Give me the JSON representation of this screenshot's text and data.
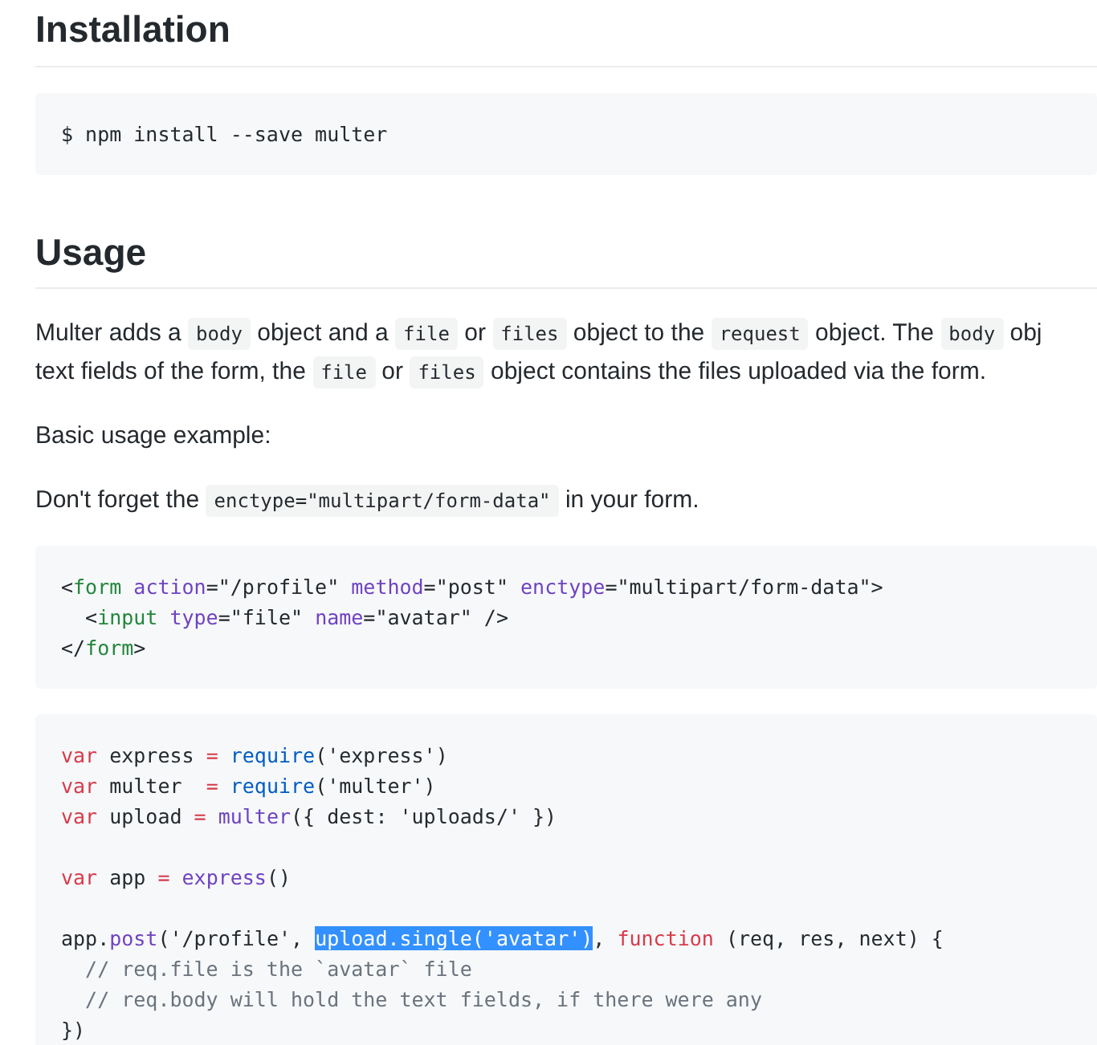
{
  "sections": [
    {
      "heading": "Installation",
      "blocks": [
        {
          "kind": "code",
          "groups": [
            [
              [
                {
                  "kind": "plain",
                  "t": "$ npm install --save multer"
                }
              ]
            ]
          ]
        }
      ]
    },
    {
      "heading": "Usage",
      "blocks": [
        {
          "kind": "paragraph",
          "lines": [
            [
              {
                "kind": "text",
                "t": "Multer adds a "
              },
              {
                "kind": "code",
                "t": "body"
              },
              {
                "kind": "text",
                "t": " object and a "
              },
              {
                "kind": "code",
                "t": "file"
              },
              {
                "kind": "text",
                "t": " or "
              },
              {
                "kind": "code",
                "t": "files"
              },
              {
                "kind": "text",
                "t": " object to the "
              },
              {
                "kind": "code",
                "t": "request"
              },
              {
                "kind": "text",
                "t": " object. The "
              },
              {
                "kind": "code",
                "t": "body"
              },
              {
                "kind": "text",
                "t": " obj"
              }
            ],
            [
              {
                "kind": "text",
                "t": "text fields of the form, the "
              },
              {
                "kind": "code",
                "t": "file"
              },
              {
                "kind": "text",
                "t": " or "
              },
              {
                "kind": "code",
                "t": "files"
              },
              {
                "kind": "text",
                "t": " object contains the files uploaded via the form."
              }
            ]
          ]
        },
        {
          "kind": "paragraph",
          "lines": [
            [
              {
                "kind": "text",
                "t": "Basic usage example:"
              }
            ]
          ]
        },
        {
          "kind": "paragraph",
          "lines": [
            [
              {
                "kind": "text",
                "t": "Don't forget the "
              },
              {
                "kind": "code",
                "t": "enctype=\"multipart/form-data\""
              },
              {
                "kind": "text",
                "t": " in your form."
              }
            ]
          ]
        },
        {
          "kind": "code",
          "groups": [
            [
              [
                {
                  "kind": "plain",
                  "t": "<"
                },
                {
                  "kind": "tag",
                  "t": "form "
                },
                {
                  "kind": "attr",
                  "t": "action"
                },
                {
                  "kind": "plain",
                  "t": "=\"/profile\" "
                },
                {
                  "kind": "attr",
                  "t": "method"
                },
                {
                  "kind": "plain",
                  "t": "=\"post\" "
                },
                {
                  "kind": "attr",
                  "t": "enctype"
                },
                {
                  "kind": "plain",
                  "t": "=\"multipart/form-data\">"
                }
              ],
              [
                {
                  "kind": "plain",
                  "t": "  <"
                },
                {
                  "kind": "tag",
                  "t": "input "
                },
                {
                  "kind": "attr",
                  "t": "type"
                },
                {
                  "kind": "plain",
                  "t": "=\"file\" "
                },
                {
                  "kind": "attr",
                  "t": "name"
                },
                {
                  "kind": "plain",
                  "t": "=\"avatar\" />"
                }
              ],
              [
                {
                  "kind": "plain",
                  "t": "</"
                },
                {
                  "kind": "tag",
                  "t": "form"
                },
                {
                  "kind": "plain",
                  "t": ">"
                }
              ]
            ]
          ]
        },
        {
          "kind": "code",
          "groups": [
            [
              [
                {
                  "kind": "keyword",
                  "t": "var"
                },
                {
                  "kind": "plain",
                  "t": " express "
                },
                {
                  "kind": "keyword",
                  "t": "= "
                },
                {
                  "kind": "builtin",
                  "t": "require"
                },
                {
                  "kind": "plain",
                  "t": "('express')"
                }
              ],
              [
                {
                  "kind": "keyword",
                  "t": "var"
                },
                {
                  "kind": "plain",
                  "t": " multer  "
                },
                {
                  "kind": "keyword",
                  "t": "= "
                },
                {
                  "kind": "builtin",
                  "t": "require"
                },
                {
                  "kind": "plain",
                  "t": "('multer')"
                }
              ],
              [
                {
                  "kind": "keyword",
                  "t": "var"
                },
                {
                  "kind": "plain",
                  "t": " upload "
                },
                {
                  "kind": "keyword",
                  "t": "= "
                },
                {
                  "kind": "func",
                  "t": "multer"
                },
                {
                  "kind": "plain",
                  "t": "({ dest: 'uploads/' })"
                }
              ]
            ],
            [
              [
                {
                  "kind": "keyword",
                  "t": "var"
                },
                {
                  "kind": "plain",
                  "t": " app "
                },
                {
                  "kind": "keyword",
                  "t": "= "
                },
                {
                  "kind": "func",
                  "t": "express"
                },
                {
                  "kind": "plain",
                  "t": "()"
                }
              ]
            ],
            [
              [
                {
                  "kind": "plain",
                  "t": "app."
                },
                {
                  "kind": "func",
                  "t": "post"
                },
                {
                  "kind": "plain",
                  "t": "('/profile', "
                },
                {
                  "kind": "selected",
                  "t": "upload.single('avatar')"
                },
                {
                  "kind": "plain",
                  "t": ", "
                },
                {
                  "kind": "keyword",
                  "t": "function"
                },
                {
                  "kind": "plain",
                  "t": " (req, res, next) {"
                }
              ],
              [
                {
                  "kind": "comment",
                  "t": "  // req.file is the `avatar` file"
                }
              ],
              [
                {
                  "kind": "comment",
                  "t": "  // req.body will hold the text fields, if there were any"
                }
              ],
              [
                {
                  "kind": "plain",
                  "t": "})"
                }
              ]
            ]
          ]
        }
      ]
    }
  ]
}
